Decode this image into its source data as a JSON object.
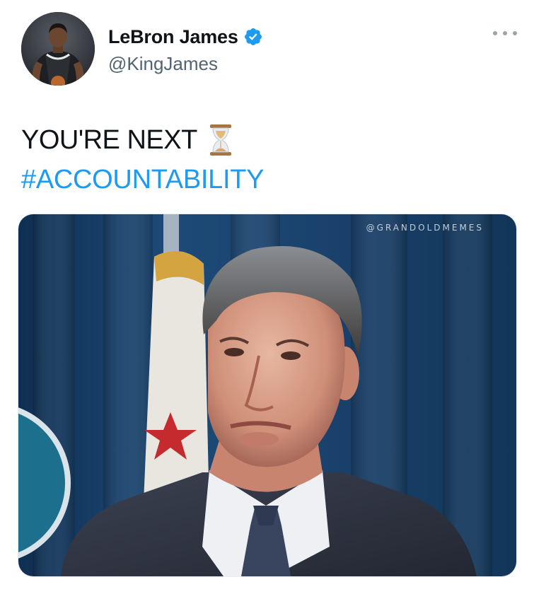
{
  "tweet": {
    "author": {
      "display_name": "LeBron James",
      "handle": "@KingJames",
      "verified": true,
      "avatar_icon": "basketball-player-avatar"
    },
    "menu_icon": "more-options-icon",
    "text_line1": "YOU'RE NEXT",
    "emoji": "hourglass-icon",
    "hashtag": "#ACCOUNTABILITY",
    "media": {
      "watermark": "@GRANDOLDMEMES",
      "description_icon": "photo-man-in-suit-in-front-of-flag"
    }
  },
  "colors": {
    "link": "#1d9bf0",
    "verified": "#1d9bf0",
    "text": "#0f1419",
    "secondary": "#536471"
  }
}
